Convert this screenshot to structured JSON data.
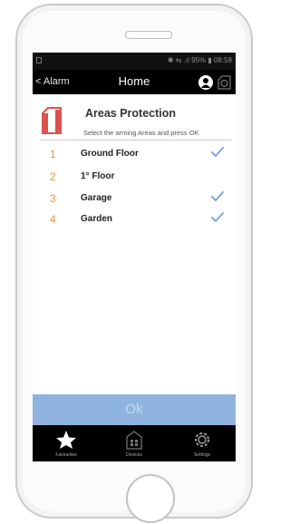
{
  "status_bar": {
    "right_text": "✱ ⇆ .ıl 95% ▮ 08:59"
  },
  "nav": {
    "back_label": "< Alarm",
    "title": "Home"
  },
  "header": {
    "title": "Areas Protection",
    "subtitle": "Select the arming Areas and press OK"
  },
  "areas": [
    {
      "number": "1",
      "label": "Ground Floor",
      "checked": true
    },
    {
      "number": "2",
      "label": "1° Floor",
      "checked": false
    },
    {
      "number": "3",
      "label": "Garage",
      "checked": true
    },
    {
      "number": "4",
      "label": "Garden",
      "checked": true
    }
  ],
  "ok_label": "Ok",
  "tabs": [
    {
      "label": "Favourites",
      "icon": "star-icon"
    },
    {
      "label": "Devices",
      "icon": "devices-icon"
    },
    {
      "label": "Settings",
      "icon": "gear-icon"
    }
  ],
  "colors": {
    "accent": "#8fb3df",
    "number": "#e8933a",
    "check": "#7fa8d6",
    "shield": "#d9534f"
  }
}
